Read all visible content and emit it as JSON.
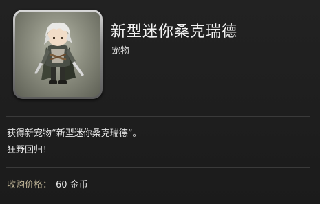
{
  "item": {
    "name": "新型迷你桑克瑞德",
    "type": "宠物",
    "icon": "chibi-character-icon"
  },
  "description": {
    "line1": "获得新宠物“新型迷你桑克瑞德”。",
    "line2": "狂野回归！"
  },
  "price": {
    "label": "收购价格：",
    "value": "60 金币"
  },
  "colors": {
    "background": "#1d1d1d",
    "price_label": "#c4b99a",
    "text": "#e4e4e4"
  }
}
